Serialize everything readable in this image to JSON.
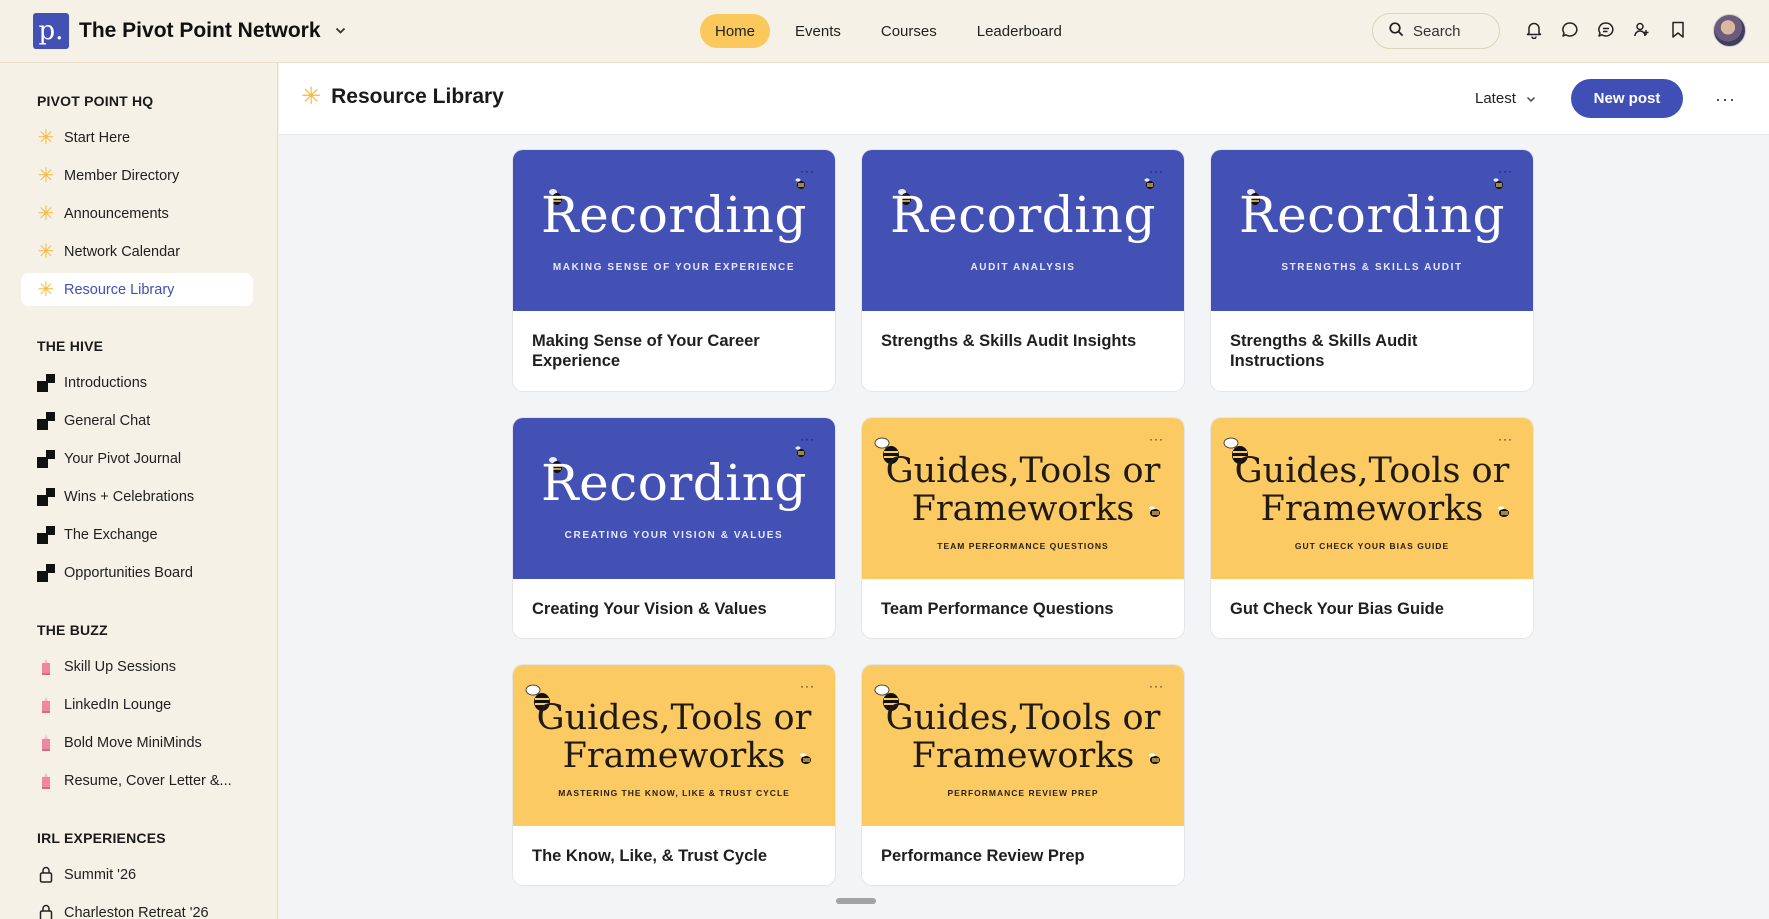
{
  "app": {
    "name": "The Pivot Point Network",
    "logo_letter": "p."
  },
  "nav": [
    {
      "label": "Home",
      "active": true
    },
    {
      "label": "Events",
      "active": false
    },
    {
      "label": "Courses",
      "active": false
    },
    {
      "label": "Leaderboard",
      "active": false
    }
  ],
  "search": {
    "label": "Search"
  },
  "top_icons": [
    "bell-icon",
    "chat-bubble-icon",
    "messages-icon",
    "people-icon",
    "bookmark-icon"
  ],
  "sidebar": {
    "sections": [
      {
        "title": "PIVOT POINT HQ",
        "items": [
          {
            "label": "Start Here",
            "icon": "sparkle-icon"
          },
          {
            "label": "Member Directory",
            "icon": "sparkle-icon"
          },
          {
            "label": "Announcements",
            "icon": "sparkle-icon"
          },
          {
            "label": "Network Calendar",
            "icon": "sparkle-icon"
          },
          {
            "label": "Resource Library",
            "icon": "sparkle-icon",
            "active": true
          }
        ]
      },
      {
        "title": "THE HIVE",
        "items": [
          {
            "label": "Introductions",
            "icon": "blocks-icon"
          },
          {
            "label": "General Chat",
            "icon": "blocks-icon"
          },
          {
            "label": "Your Pivot Journal",
            "icon": "blocks-icon"
          },
          {
            "label": "Wins + Celebrations",
            "icon": "blocks-icon"
          },
          {
            "label": "The Exchange",
            "icon": "blocks-icon"
          },
          {
            "label": "Opportunities Board",
            "icon": "blocks-icon"
          }
        ]
      },
      {
        "title": "THE BUZZ",
        "items": [
          {
            "label": "Skill Up Sessions",
            "icon": "pencil-icon"
          },
          {
            "label": "LinkedIn Lounge",
            "icon": "pencil-icon"
          },
          {
            "label": "Bold Move MiniMinds",
            "icon": "pencil-icon"
          },
          {
            "label": "Resume, Cover Letter &...",
            "icon": "pencil-icon"
          }
        ]
      },
      {
        "title": "IRL EXPERIENCES",
        "items": [
          {
            "label": "Summit '26",
            "icon": "lock-icon"
          },
          {
            "label": "Charleston Retreat '26",
            "icon": "lock-icon"
          }
        ]
      }
    ]
  },
  "main": {
    "title": "Resource Library",
    "sort_label": "Latest",
    "new_post_label": "New post",
    "more_label": "···"
  },
  "cards": [
    {
      "style": "recording",
      "heading": "Recording",
      "subheading": "MAKING SENSE OF YOUR EXPERIENCE",
      "title": "Making Sense of Your Career Experience"
    },
    {
      "style": "recording",
      "heading": "Recording",
      "subheading": "AUDIT ANALYSIS",
      "title": "Strengths & Skills Audit Insights"
    },
    {
      "style": "recording",
      "heading": "Recording",
      "subheading": "STRENGTHS & SKILLS AUDIT",
      "title": "Strengths & Skills Audit Instructions"
    },
    {
      "style": "recording",
      "heading": "Recording",
      "subheading": "CREATING YOUR VISION & VALUES",
      "title": "Creating Your Vision & Values"
    },
    {
      "style": "guide",
      "heading_line1": "Guides,Tools or",
      "heading_line2": "Frameworks",
      "subheading": "TEAM PERFORMANCE QUESTIONS",
      "title": "Team Performance Questions"
    },
    {
      "style": "guide",
      "heading_line1": "Guides,Tools or",
      "heading_line2": "Frameworks",
      "subheading": "GUT CHECK YOUR BIAS GUIDE",
      "title": "Gut Check Your Bias Guide"
    },
    {
      "style": "guide",
      "heading_line1": "Guides,Tools or",
      "heading_line2": "Frameworks",
      "subheading": "MASTERING THE KNOW, LIKE & TRUST CYCLE",
      "title": "The Know, Like, & Trust Cycle"
    },
    {
      "style": "guide",
      "heading_line1": "Guides,Tools or",
      "heading_line2": "Frameworks",
      "subheading": "PERFORMANCE REVIEW PREP",
      "title": "Performance Review Prep"
    }
  ],
  "colors": {
    "brand": "#4351b5",
    "accent": "#fbc95b",
    "sidebar_bg": "#f5f1e6"
  }
}
